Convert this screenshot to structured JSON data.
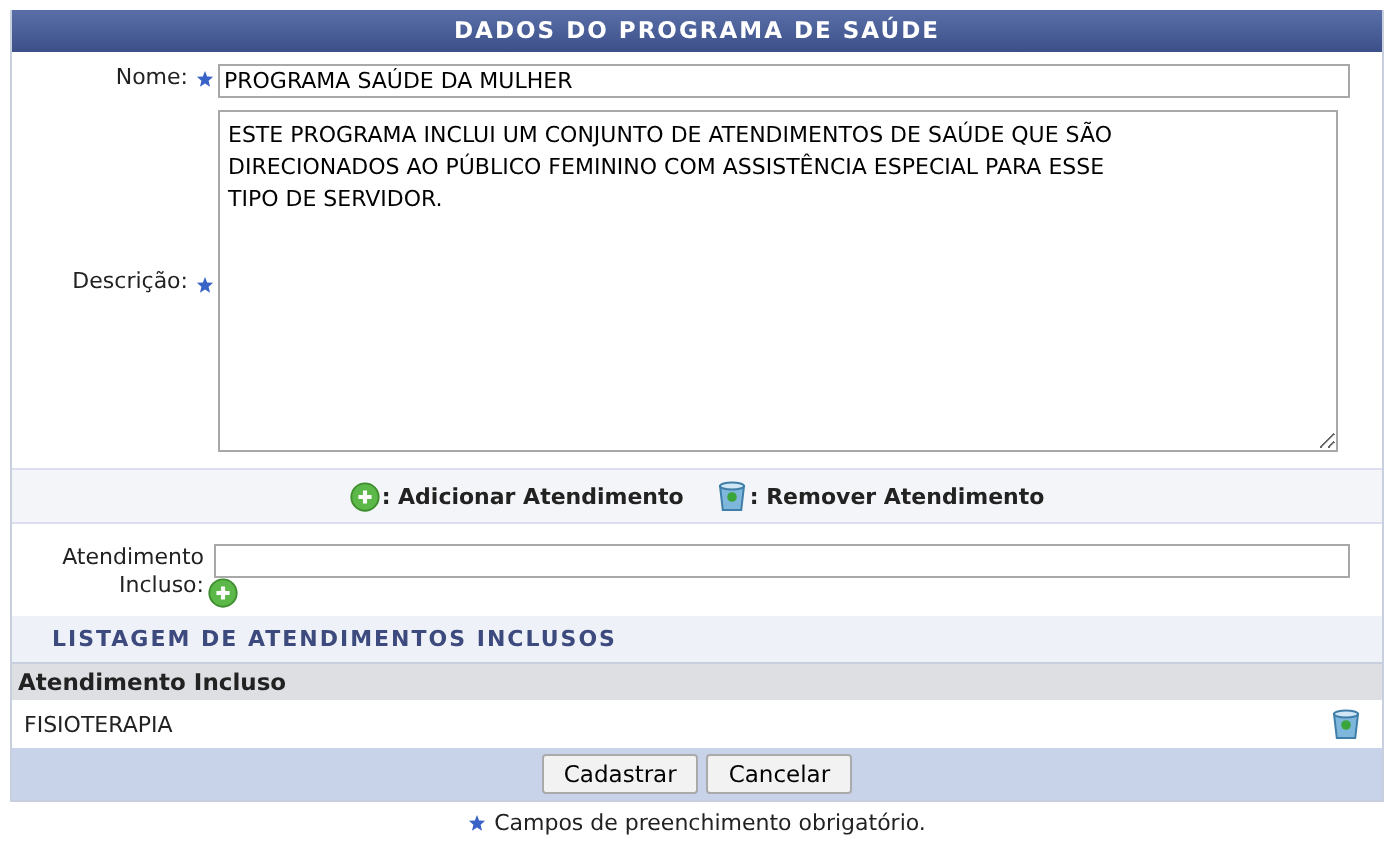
{
  "title": "DADOS DO PROGRAMA DE SAÚDE",
  "fields": [
    {
      "label": "Nome:",
      "required": true,
      "kind": "text",
      "value": "PROGRAMA SAÚDE DA MULHER"
    },
    {
      "label": "Descrição:",
      "required": true,
      "kind": "textarea",
      "value": "ESTE PROGRAMA INCLUI UM CONJUNTO DE ATENDIMENTOS DE SAÚDE QUE SÃO DIRECIONADOS AO PÚBLICO FEMININO COM ASSISTÊNCIA ESPECIAL PARA ESSE TIPO DE SERVIDOR."
    }
  ],
  "legend": [
    {
      "kind": "add",
      "label": ": Adicionar Atendimento"
    },
    {
      "kind": "remove",
      "label": ": Remover Atendimento"
    }
  ],
  "attendance_field": {
    "label": "Atendimento Incluso:"
  },
  "listing": {
    "title": "LISTAGEM DE ATENDIMENTOS INCLUSOS",
    "columns": [
      "Atendimento Incluso"
    ],
    "rows": [
      {
        "name": "FISIOTERAPIA"
      }
    ]
  },
  "buttons": [
    "Cadastrar",
    "Cancelar"
  ],
  "footnote": "Campos de preenchimento obrigatório."
}
